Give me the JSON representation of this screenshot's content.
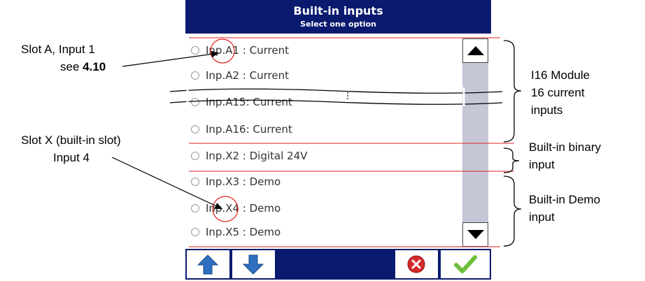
{
  "dialog": {
    "title": "Built-in inputs",
    "subtitle": "Select one option"
  },
  "list_items": [
    {
      "label": "Inp.A1 : Current"
    },
    {
      "label": "Inp.A2 : Current"
    },
    {
      "label": "Inp.A15: Current"
    },
    {
      "label": "Inp.A16: Current"
    },
    {
      "label": "Inp.X2 : Digital 24V"
    },
    {
      "label": "Inp.X3 : Demo"
    },
    {
      "label": "Inp.X4 : Demo"
    },
    {
      "label": "Inp.X5 : Demo"
    }
  ],
  "annotations": {
    "slot_a_line1": "Slot A, Input 1",
    "slot_a_see": "see ",
    "slot_a_ref": "4.10",
    "slot_x_line1": "Slot X (built-in slot)",
    "slot_x_line2": "Input 4",
    "i16_line1": "I16 Module",
    "i16_line2": "16 current",
    "i16_line3": "inputs",
    "binary_line1": "Built-in binary",
    "binary_line2": "input",
    "demo_line1": "Built-in Demo",
    "demo_line2": "input"
  },
  "colors": {
    "header_bg": "#0a1a6e",
    "highlight_red": "#e02020",
    "cancel_red": "#d42a2a",
    "ok_green": "#6cbf3a",
    "arrow_blue": "#2f6fc0"
  },
  "icons": {
    "scroll_up": "triangle-up-icon",
    "scroll_down": "triangle-down-icon",
    "move_up": "arrow-up-icon",
    "move_down": "arrow-down-icon",
    "cancel": "cancel-x-icon",
    "ok": "checkmark-icon"
  }
}
